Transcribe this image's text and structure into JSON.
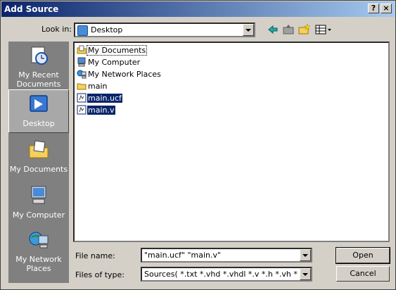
{
  "window": {
    "title": "Add Source"
  },
  "title_buttons": {
    "help": "?",
    "close": "×"
  },
  "lookin": {
    "label": "Look in:",
    "value": "Desktop"
  },
  "toolbar": {
    "icons": [
      "back-icon",
      "up-folder-icon",
      "new-folder-icon",
      "view-menu-icon"
    ]
  },
  "places": [
    {
      "label": "My Recent Documents",
      "icon": "recent-documents-icon",
      "selected": false
    },
    {
      "label": "Desktop",
      "icon": "desktop-icon",
      "selected": true
    },
    {
      "label": "My Documents",
      "icon": "my-documents-icon",
      "selected": false
    },
    {
      "label": "My Computer",
      "icon": "my-computer-icon",
      "selected": false
    },
    {
      "label": "My Network Places",
      "icon": "network-places-icon",
      "selected": false
    }
  ],
  "files": [
    {
      "name": "My Documents",
      "icon": "documents-folder-icon",
      "selected": false
    },
    {
      "name": "My Computer",
      "icon": "computer-icon",
      "selected": false
    },
    {
      "name": "My Network Places",
      "icon": "network-icon",
      "selected": false
    },
    {
      "name": "main",
      "icon": "folder-icon",
      "selected": false
    },
    {
      "name": "main.ucf",
      "icon": "file-icon",
      "selected": true
    },
    {
      "name": "main.v",
      "icon": "file-icon",
      "selected": true
    }
  ],
  "filename": {
    "label": "File name:",
    "value": "\"main.ucf\" \"main.v\""
  },
  "filetype": {
    "label": "Files of type:",
    "value": "Sources( *.txt *.vhd *.vhdl *.v *.h *.vh *.xco *.sc"
  },
  "buttons": {
    "open": "Open",
    "cancel": "Cancel"
  }
}
